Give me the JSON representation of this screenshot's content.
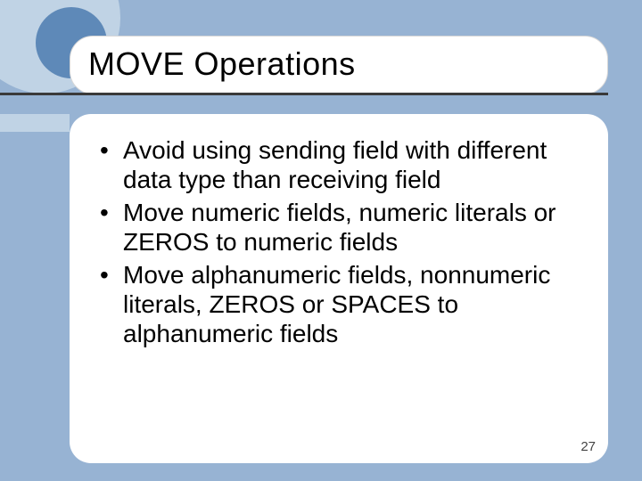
{
  "title": "MOVE Operations",
  "bullets": [
    "Avoid using sending field with different data type than receiving field",
    "Move numeric fields, numeric literals or ZEROS to numeric fields",
    "Move alphanumeric fields, nonnumeric literals, ZEROS or SPACES to alphanumeric fields"
  ],
  "page_number": "27"
}
